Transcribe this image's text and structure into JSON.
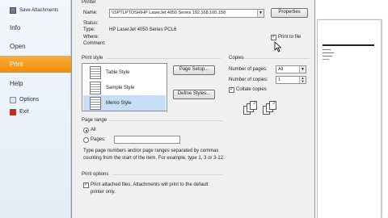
{
  "sidebar": {
    "items": [
      {
        "label": "Save Attachments",
        "icon": "save-attachments-icon"
      },
      {
        "label": "Info"
      },
      {
        "label": "Open"
      },
      {
        "label": "Print",
        "active": true
      },
      {
        "label": "Help"
      },
      {
        "label": "Options",
        "icon": "options-icon"
      },
      {
        "label": "Exit",
        "icon": "exit-icon"
      }
    ]
  },
  "dialog": {
    "printer": {
      "section_label": "Printer",
      "name_label": "Name:",
      "name_value": "\\\\SPTLPTOSH\\HP LaserJet 4050 Series 192.168.100.158",
      "properties_button": "Properties",
      "status_label": "Status:",
      "type_label": "Type:",
      "type_value": "HP LaserJet 4050 Series PCL6",
      "where_label": "Where:",
      "comment_label": "Comment:",
      "print_to_file_label": "Print to file",
      "print_to_file_checked": true
    },
    "print_style": {
      "section_label": "Print style",
      "items": [
        "Table Style",
        "Sample Style",
        "Memo Style"
      ],
      "selected": "Memo Style",
      "page_setup_button": "Page Setup...",
      "define_styles_button": "Define Styles..."
    },
    "copies": {
      "section_label": "Copies",
      "pages_label": "Number of pages:",
      "pages_value": "All",
      "copies_label": "Number of copies:",
      "copies_value": "1",
      "collate_label": "Collate copies",
      "collate_checked": true,
      "collate_pages": [
        "1",
        "2",
        "3",
        "1",
        "2",
        "3"
      ]
    },
    "page_range": {
      "section_label": "Page range",
      "all_label": "All",
      "pages_label": "Pages:",
      "pages_value": "",
      "help_text": "Type page numbers and/or page ranges separated by commas counting from the start of the item.  For example, type 1, 3 or 3-12."
    },
    "print_options": {
      "section_label": "Print options",
      "attached_label": "Print attached files.  Attachments will print to the default printer only.",
      "attached_checked": true
    }
  },
  "colors": {
    "print_active": "#f39b1f",
    "sidebar_bg": "#e9eff7",
    "dialog_bg": "#f0f0f0",
    "selection": "#c8def6"
  }
}
